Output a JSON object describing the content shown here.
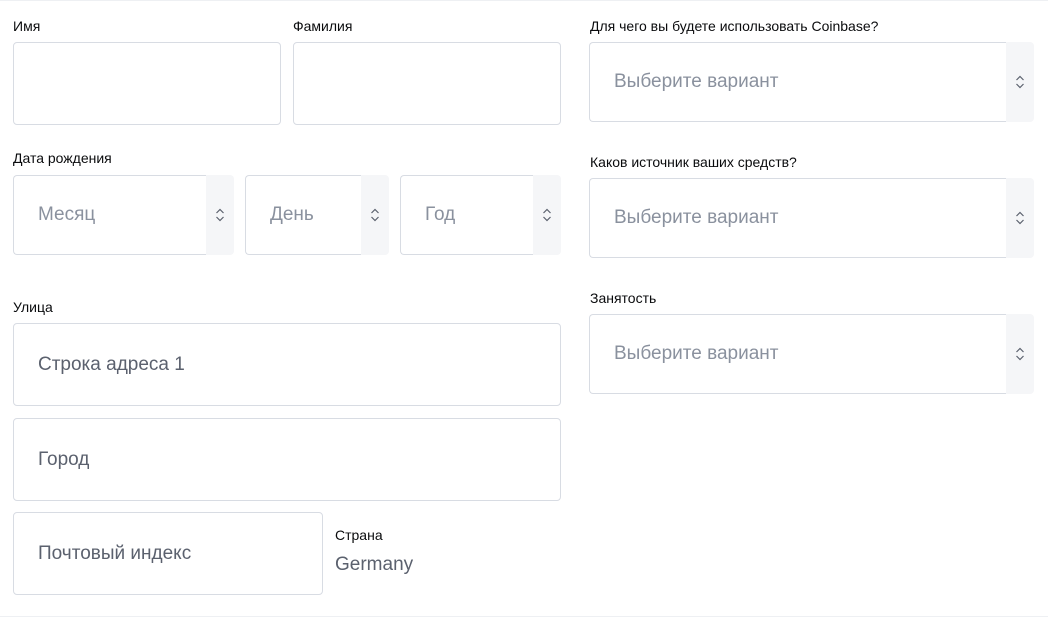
{
  "name": {
    "first_label": "Имя",
    "first_value": "",
    "last_label": "Фамилия",
    "last_value": ""
  },
  "dob": {
    "label": "Дата рождения",
    "month_placeholder": "Месяц",
    "day_placeholder": "День",
    "year_placeholder": "Год"
  },
  "address": {
    "label": "Улица",
    "line1_placeholder": "Строка адреса 1",
    "city_placeholder": "Город",
    "postal_placeholder": "Почтовый индекс",
    "country_label": "Страна",
    "country_value": "Germany"
  },
  "questions": {
    "usage_label": "Для чего вы будете использовать Coinbase?",
    "usage_placeholder": "Выберите вариант",
    "funds_label": "Каков источник ваших средств?",
    "funds_placeholder": "Выберите вариант",
    "employment_label": "Занятость",
    "employment_placeholder": "Выберите вариант"
  },
  "icons": {
    "select_arrow": "chevron-up-down-icon"
  },
  "colors": {
    "border": "#d8dce3",
    "placeholder": "#8a919e",
    "text": "#0a0b0d",
    "arrow_bg": "#f5f6f8"
  }
}
